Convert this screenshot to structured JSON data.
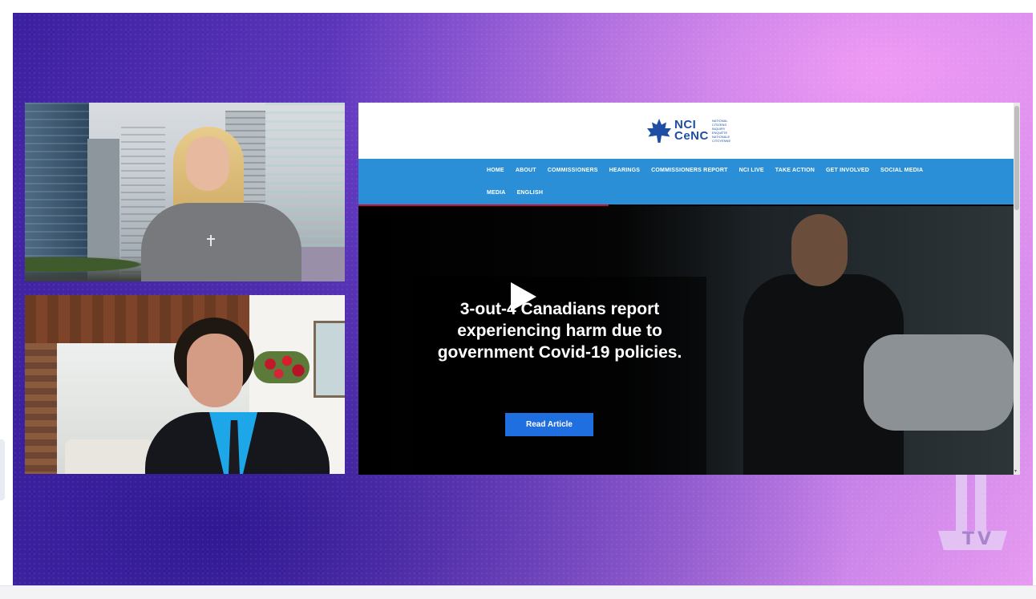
{
  "website": {
    "logo": {
      "line1": "NCI",
      "line2": "CeNC",
      "sub1": "NATIONAL CITIZENS INQUIRY",
      "sub2": "ENQUÊTE NATIONALE CITOYENNE"
    },
    "nav_row1": [
      "HOME",
      "ABOUT",
      "COMMISSIONERS",
      "HEARINGS",
      "COMMISSIONERS REPORT",
      "NCI LIVE",
      "TAKE ACTION",
      "GET INVOLVED",
      "SOCIAL MEDIA"
    ],
    "nav_row2": [
      "MEDIA",
      "ENGLISH"
    ],
    "hero": {
      "title": "3-out-4 Canadians report experiencing harm due to government Covid-19 policies.",
      "button": "Read Article"
    }
  },
  "broadcast_logo": {
    "text": "TV"
  },
  "colors": {
    "nav_blue": "#2a8fd6",
    "button_blue": "#1f6fe0",
    "brand_blue": "#1e4fa2",
    "brand_red": "#c8102e"
  },
  "icons": [
    "play-icon",
    "maple-leaf-logo",
    "tv-network-logo"
  ]
}
